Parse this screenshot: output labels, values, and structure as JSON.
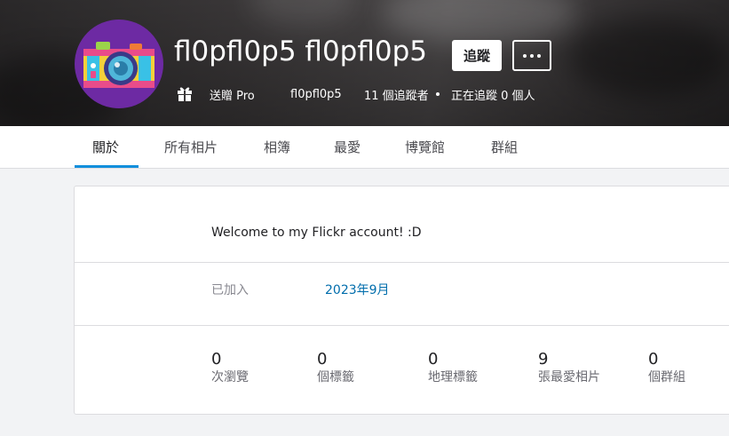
{
  "profile": {
    "username": "fl0pfl0p5 fl0pfl0p5",
    "follow_label": "追蹤",
    "more_label": "...",
    "pro_label": "送贈 Pro",
    "handle": "fl0pfl0p5",
    "followers": "11 個追蹤者",
    "following": "正在追蹤 0 個人"
  },
  "tabs": [
    {
      "label": "關於",
      "active": true
    },
    {
      "label": "所有相片",
      "active": false
    },
    {
      "label": "相簿",
      "active": false
    },
    {
      "label": "最愛",
      "active": false
    },
    {
      "label": "博覽館",
      "active": false
    },
    {
      "label": "群組",
      "active": false
    }
  ],
  "about": {
    "description": "Welcome to my Flickr account! :D",
    "joined_label": "已加入",
    "joined_value": "2023年9月",
    "stats": [
      {
        "value": "0",
        "label": "次瀏覽"
      },
      {
        "value": "0",
        "label": "個標籤"
      },
      {
        "value": "0",
        "label": "地理標籤"
      },
      {
        "value": "9",
        "label": "張最愛相片"
      },
      {
        "value": "0",
        "label": "個群組"
      }
    ]
  },
  "colors": {
    "accent": "#128fdc",
    "link": "#006dac",
    "avatar_bg": "#6d2aa3"
  },
  "icons": {
    "gift": "gift-icon",
    "more": "ellipsis-icon",
    "avatar": "camera-avatar"
  }
}
